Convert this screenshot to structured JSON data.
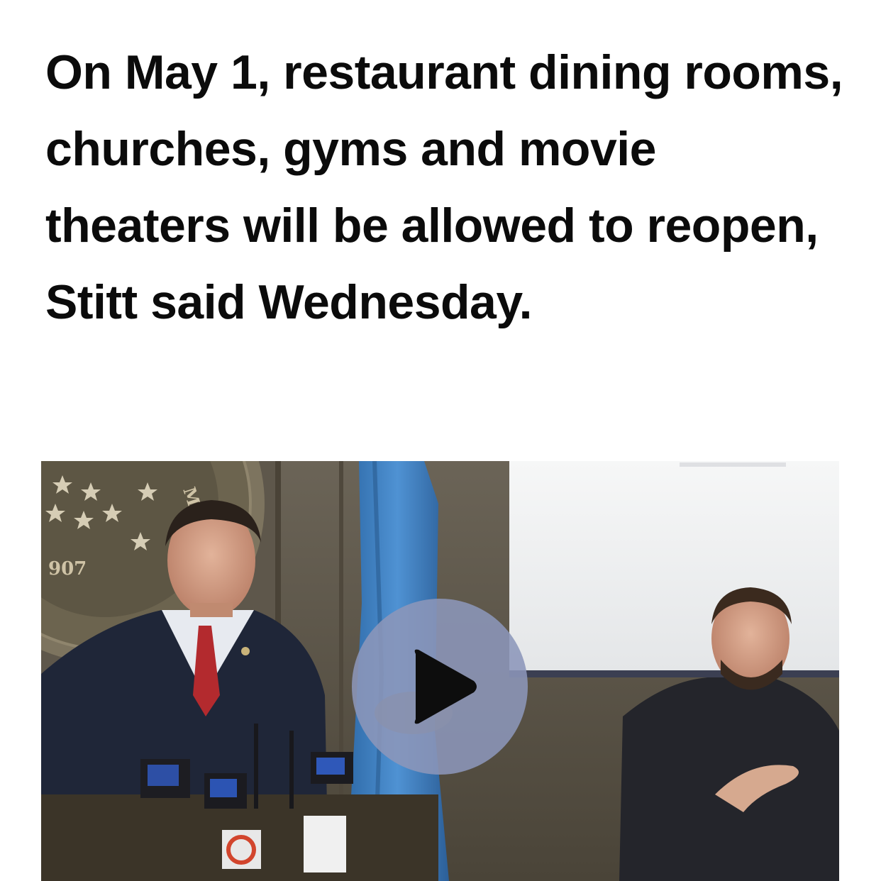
{
  "article": {
    "headline": "On May 1, restaurant dining rooms, churches, gyms and movie theaters will be allowed to reopen, Stitt said Wednesday."
  },
  "video": {
    "play_icon": "play-icon",
    "seal_year_text": "907",
    "seal_motto_text": "MA"
  },
  "colors": {
    "play_button_bg": "#8c96b9",
    "play_triangle": "#0d0d0d",
    "flag_blue": "#3d7ec2"
  }
}
